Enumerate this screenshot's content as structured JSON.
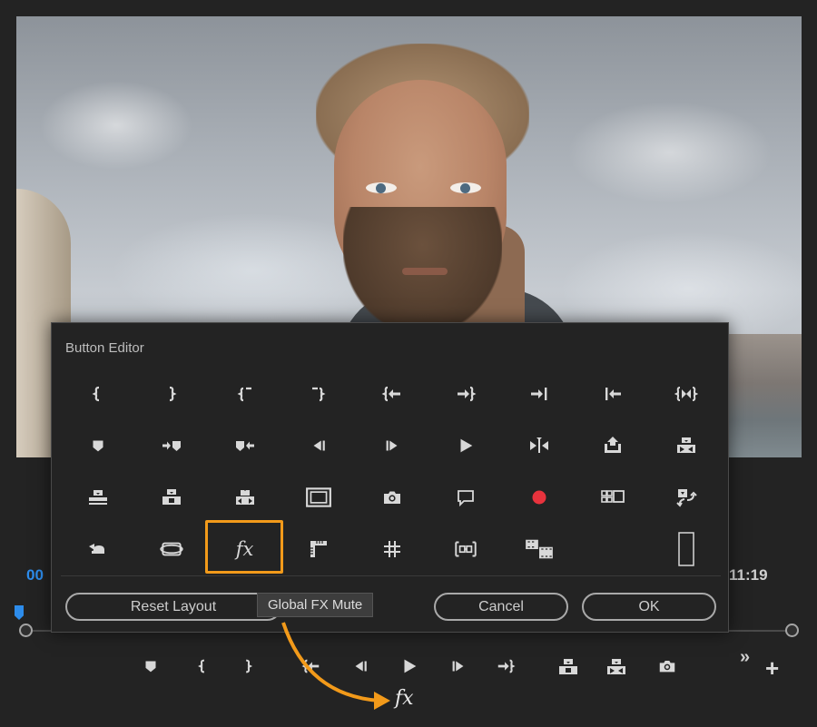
{
  "dialog": {
    "title": "Button Editor",
    "reset_label": "Reset Layout",
    "cancel_label": "Cancel",
    "ok_label": "OK",
    "tooltip": "Global FX Mute",
    "fx_symbol": "fx"
  },
  "timecode": {
    "current": "00",
    "duration": "11:19"
  },
  "transport": {
    "overflow_label": "»",
    "add_label": "+",
    "fx_symbol": "fx"
  },
  "colors": {
    "accent_blue": "#2d8ceb",
    "highlight_orange": "#f29a1a",
    "record_red": "#e8333d",
    "icon": "#d8d8d8"
  },
  "grid_icons": [
    "mark-in-icon",
    "mark-out-icon",
    "mark-clip-in-icon",
    "mark-clip-out-icon",
    "go-to-in-icon",
    "go-to-out-icon",
    "go-to-next-edit-icon",
    "go-to-previous-edit-icon",
    "play-in-to-out-icon",
    "add-marker-icon",
    "go-to-next-marker-icon",
    "go-to-previous-marker-icon",
    "step-back-icon",
    "step-forward-icon",
    "play-icon",
    "play-around-icon",
    "lift-icon",
    "extract-icon",
    "insert-icon",
    "overwrite-icon",
    "replace-icon",
    "safe-margins-icon",
    "export-frame-icon",
    "comment-icon",
    "record-icon",
    "multi-camera-icon",
    "toggle-proxies-icon",
    "undo-icon",
    "vr-video-icon",
    "global-fx-mute-icon",
    "show-rulers-icon",
    "show-guides-icon",
    "snap-in-program-monitor-icon",
    "compare-view-icon",
    "spacer-icon"
  ],
  "transport_icons": [
    "add-marker-icon",
    "mark-in-icon",
    "mark-out-icon",
    "go-to-in-icon",
    "step-back-icon",
    "play-icon",
    "step-forward-icon",
    "go-to-out-icon",
    "lift-icon",
    "extract-icon",
    "export-frame-icon"
  ]
}
